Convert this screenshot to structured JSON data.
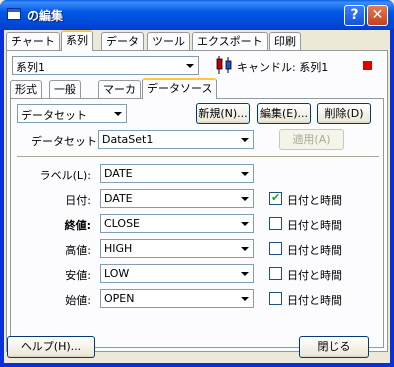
{
  "window": {
    "title": "の編集",
    "help_glyph": "?",
    "close_glyph": "✕"
  },
  "top_tabs": [
    "チャート",
    "系列",
    "データ",
    "ツール",
    "エクスポート",
    "印刷"
  ],
  "series_select": {
    "value": "系列1"
  },
  "series_info": {
    "icon": "candle-chart-icon",
    "label": "キャンドル: 系列1",
    "color": "#e00000"
  },
  "sub_tabs": [
    "形式",
    "一般",
    "マーカ",
    "データソース"
  ],
  "source_type_select": {
    "value": "データセット"
  },
  "buttons": {
    "new": "新規(N)...",
    "edit": "編集(E)...",
    "delete": "削除(D)",
    "apply": "適用(A)",
    "help": "ヘルプ(H)...",
    "close": "閉じる"
  },
  "dataset": {
    "label": "データセット(D):",
    "value": "DataSet1"
  },
  "fields": [
    {
      "label": "ラベル(L):",
      "value": "DATE",
      "has_check": false
    },
    {
      "label": "日付:",
      "value": "DATE",
      "has_check": true,
      "checked": true,
      "check_label": "日付と時間"
    },
    {
      "label": "終値:",
      "value": "CLOSE",
      "has_check": true,
      "checked": false,
      "check_label": "日付と時間",
      "bold": true
    },
    {
      "label": "高値:",
      "value": "HIGH",
      "has_check": true,
      "checked": false,
      "check_label": "日付と時間"
    },
    {
      "label": "安値:",
      "value": "LOW",
      "has_check": true,
      "checked": false,
      "check_label": "日付と時間"
    },
    {
      "label": "始値:",
      "value": "OPEN",
      "has_check": true,
      "checked": false,
      "check_label": "日付と時間"
    }
  ]
}
